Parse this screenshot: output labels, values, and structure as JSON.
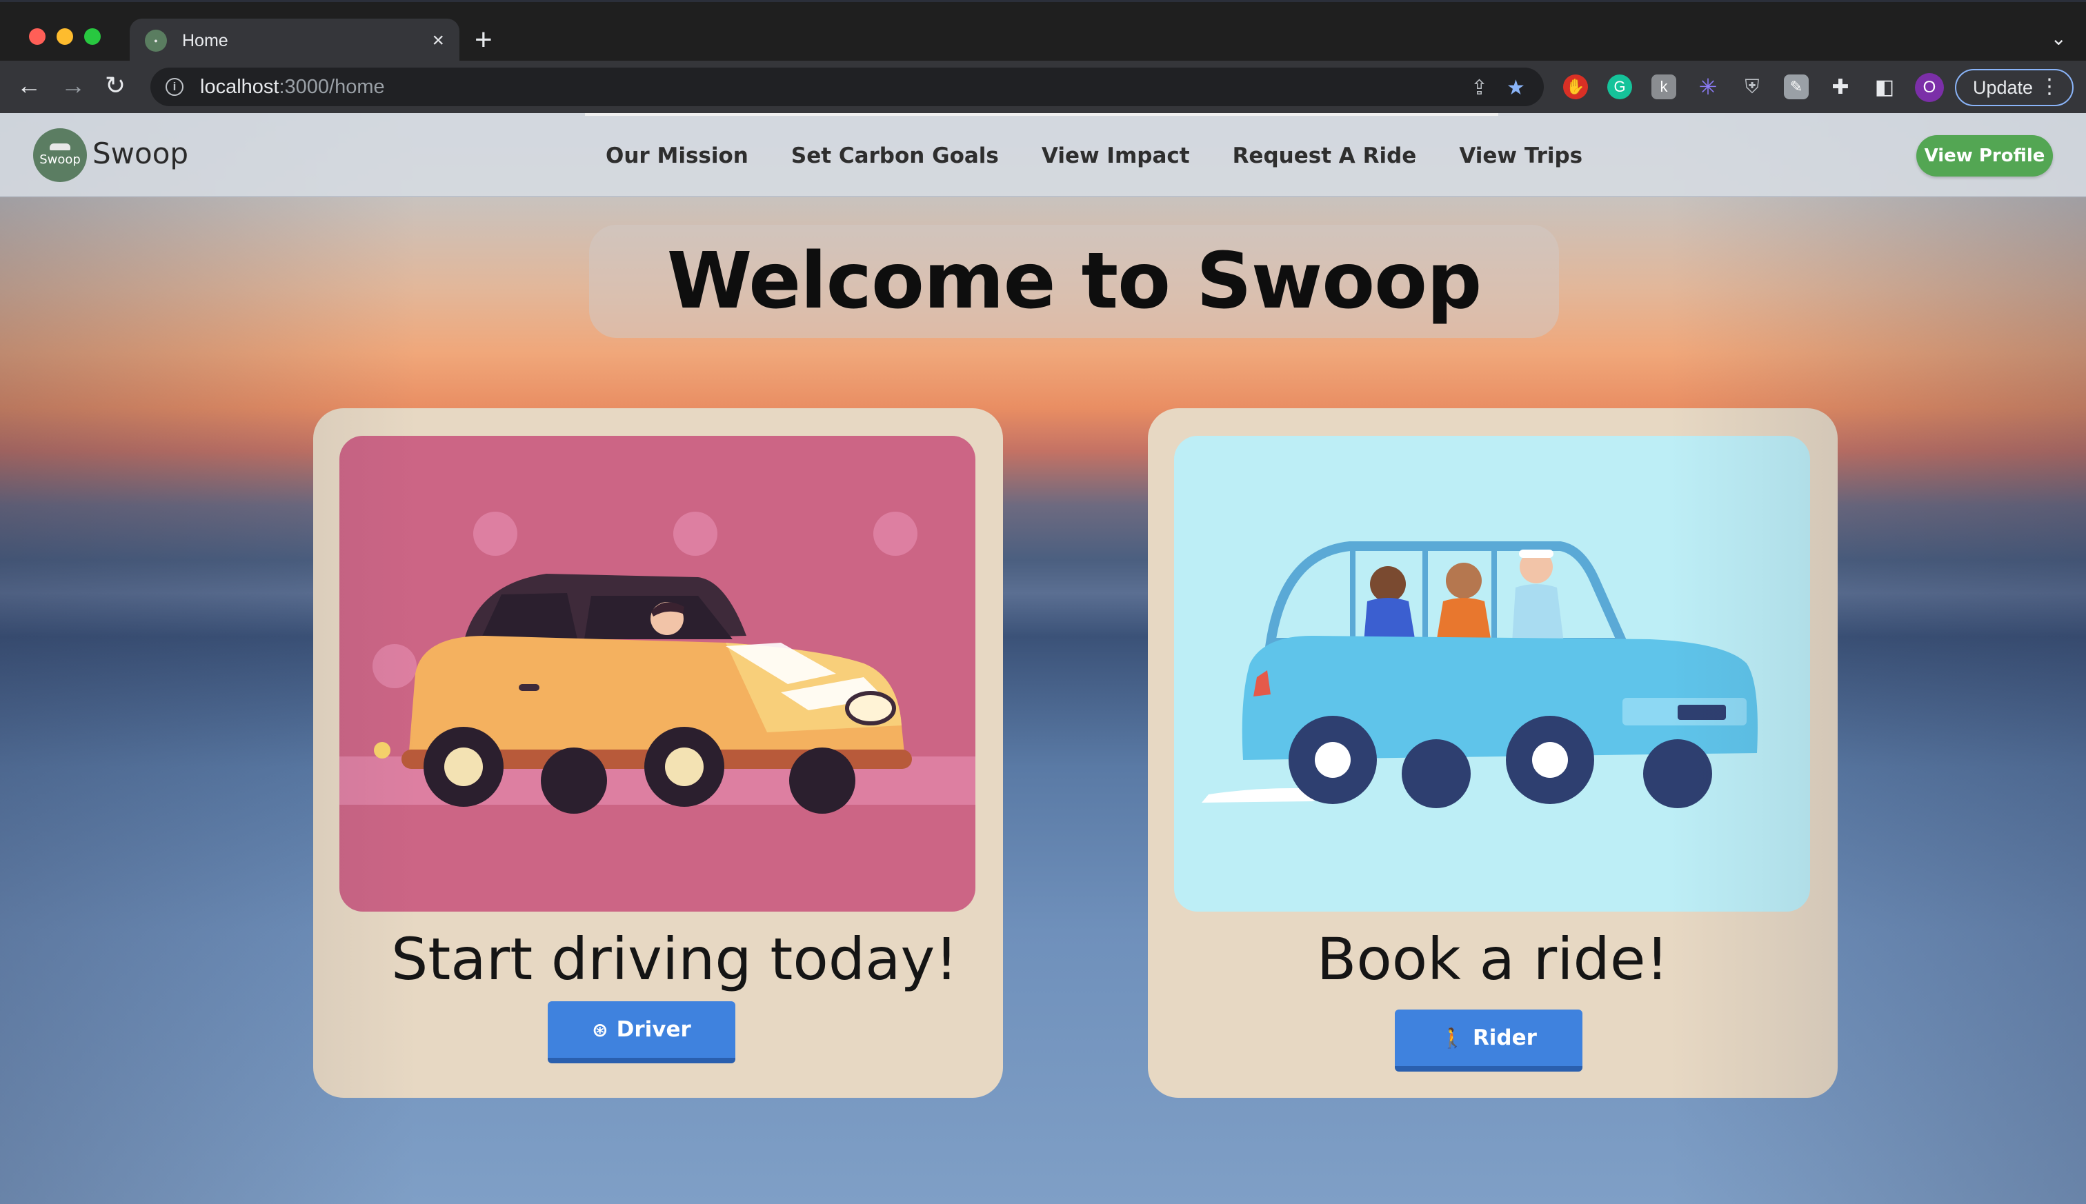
{
  "browser": {
    "tab_title": "Home",
    "tab_close": "×",
    "new_tab": "+",
    "tab_menu": "⌄",
    "url_host": "localhost",
    "url_path": ":3000/home",
    "profile_initial": "O",
    "update_label": "Update",
    "menu_dots": "⋮"
  },
  "navbar": {
    "logo_text": "Swoop",
    "brand": "Swoop",
    "links": [
      "Our Mission",
      "Set Carbon Goals",
      "View Impact",
      "Request A Ride",
      "View Trips"
    ],
    "profile_button": "View Profile"
  },
  "hero": {
    "title": "Welcome to Swoop"
  },
  "cards": {
    "driver": {
      "heading": "Start driving today!",
      "button": "Driver",
      "image_color": "#cc6585"
    },
    "rider": {
      "heading": "Book a ride!",
      "button": "Rider",
      "image_color": "#bdeef6"
    }
  },
  "colors": {
    "accent_green": "#53a653",
    "button_blue": "#3f82de",
    "card_bg": "#e7d8c3"
  }
}
